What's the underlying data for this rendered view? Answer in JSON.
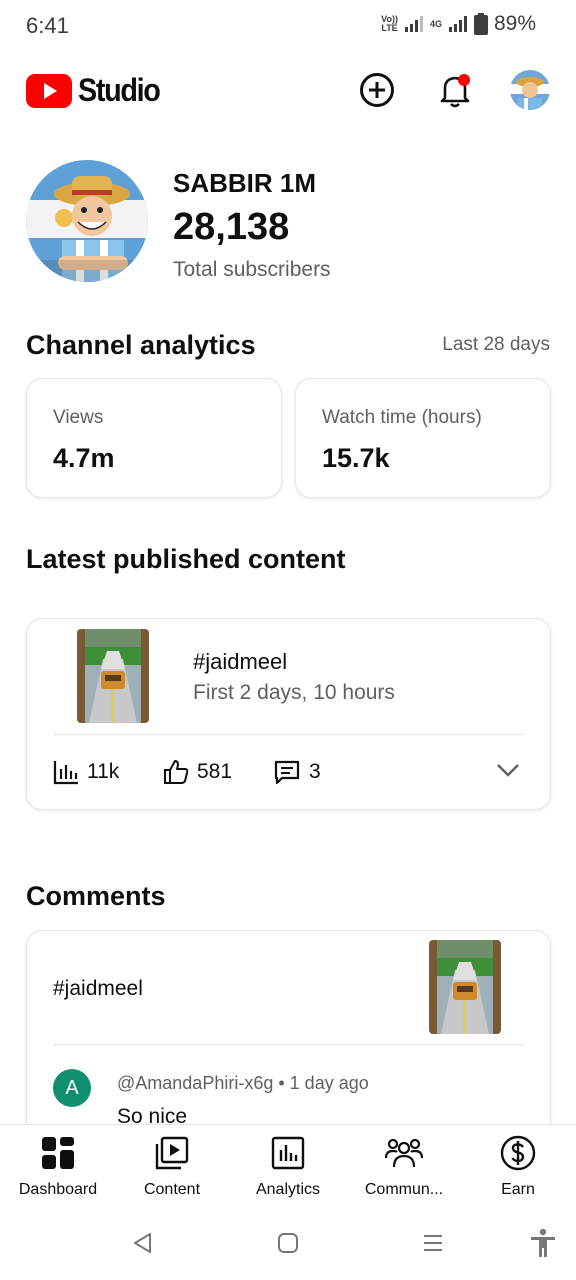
{
  "status_bar": {
    "time": "6:41",
    "network_top": "Vo))",
    "network_bottom": "LTE",
    "network_4g": "4G",
    "battery_percent": "89%"
  },
  "header": {
    "app_name": "Studio",
    "brand_color": "#ff0000",
    "notification_badge": true
  },
  "channel": {
    "name": "SABBIR 1M",
    "subscriber_count": "28,138",
    "subscriber_label": "Total subscribers"
  },
  "analytics": {
    "title": "Channel analytics",
    "period": "Last 28 days",
    "metrics": [
      {
        "label": "Views",
        "value": "4.7m"
      },
      {
        "label": "Watch time (hours)",
        "value": "15.7k"
      }
    ]
  },
  "latest_content": {
    "title": "Latest published content",
    "video_title": "#jaidmeel",
    "video_subtitle": "First 2 days, 10 hours",
    "views": "11k",
    "likes": "581",
    "comments": "3"
  },
  "comments": {
    "title": "Comments",
    "video_title": "#jaidmeel",
    "commenter_initial": "A",
    "commenter_avatar_color": "#0f8f6f",
    "author": "@AmandaPhiri-x6g",
    "time": "1 day ago",
    "text": "So nice"
  },
  "bottom_nav": {
    "items": [
      {
        "label": "Dashboard",
        "icon": "dashboard-icon",
        "active": true
      },
      {
        "label": "Content",
        "icon": "content-icon"
      },
      {
        "label": "Analytics",
        "icon": "analytics-icon"
      },
      {
        "label": "Commun...",
        "icon": "community-icon"
      },
      {
        "label": "Earn",
        "icon": "earn-icon"
      }
    ]
  }
}
